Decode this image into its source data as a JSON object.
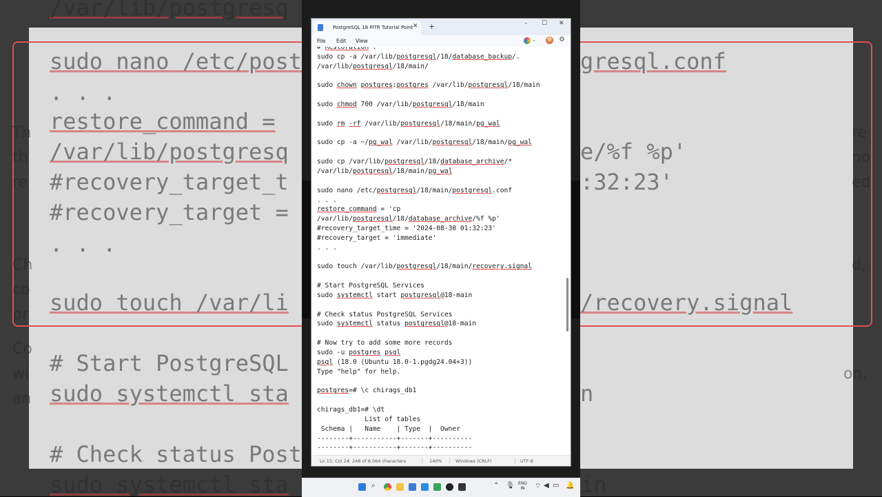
{
  "background": {
    "code_lines": [
      "/var/lib/postgresq",
      "sudo nano /etc/post",
      ". . .",
      "restore_command =",
      "/var/lib/postgresq",
      "#recovery_target_t",
      "#recovery_target =",
      ". . .",
      "sudo touch /var/li",
      "# Start PostgreSQL",
      "sudo systemctl sta",
      "# Check status Post",
      "sudo systemctl sta"
    ],
    "right_fragments": [
      "gresql.conf",
      "e/%f %p'",
      ":32:23'",
      "/recovery.signal",
      "n",
      "in"
    ],
    "left_fragments": [
      "Th",
      "th",
      "re",
      "Ch",
      "co",
      "pr",
      "Co",
      "wi",
      "an"
    ],
    "side_fragments_right": [
      "re",
      "no",
      "ed",
      "d,",
      "on,"
    ]
  },
  "window": {
    "tab_title": "PostgreSQL 18 PITR Tutorial  Point",
    "menu": [
      "File",
      "Edit",
      "View"
    ],
    "controls": {
      "minimize": "–",
      "maximize": "☐",
      "close": "✕"
    },
    "new_tab": "+",
    "tab_close": "✕"
  },
  "editor": {
    "lines": [
      "# Restoration :",
      "sudo cp -a /var/lib/postgresql/18/database_backup/.",
      "/var/lib/postgresql/18/main/",
      "",
      "sudo chown postgres:postgres /var/lib/postgresql/18/main",
      "",
      "sudo chmod 700 /var/lib/postgresql/18/main",
      "",
      "sudo rm -rf /var/lib/postgresql/18/main/pg_wal",
      "",
      "sudo cp -a ~/pg_wal /var/lib/postgresql/18/main/pg_wal",
      "",
      "sudo cp /var/lib/postgresql/18/database_archive/*",
      "/var/lib/postgresql/18/main/pg_wal",
      "",
      "sudo nano /etc/postgresql/18/main/postgresql.conf",
      ". . .",
      "restore_command = 'cp",
      "/var/lib/postgresql/18/database_archive/%f %p'",
      "#recovery_target_time = '2024-08-30 01:32:23'",
      "#recovery_target = 'immediate'",
      ". . .",
      "",
      "sudo touch /var/lib/postgresql/18/main/recovery.signal",
      "",
      "# Start PostgreSQL Services",
      "sudo systemctl start postgresql@18-main",
      "",
      "# Check status PostgreSQL Services",
      "sudo systemctl status postgresql@18-main",
      "",
      "# Now try to add some more records",
      "sudo -u postgres psql",
      "psql (18.0 (Ubuntu 18.0-1.pgdg24.04+3))",
      "Type \"help\" for help.",
      "",
      "postgres=# \\c chirags_db1",
      "",
      "chirags_db1=# \\dt",
      "            List of tables",
      " Schema |   Name    | Type  |  Owner",
      "--------+-----------+-------+----------",
      "--------+-----------+-------+----------"
    ]
  },
  "status_bar": {
    "position": "Ln 15, Col 24",
    "characters": "248 of 8,064 characters",
    "zoom": "140%",
    "line_ending": "Windows (CRLF)",
    "encoding": "UTF-8"
  },
  "taskbar": {
    "language": [
      "ENG",
      "IN"
    ]
  },
  "colors": {
    "squiggle": "#e34646",
    "titlebar": "#e8edf6",
    "accent": "#3c7bd6"
  }
}
